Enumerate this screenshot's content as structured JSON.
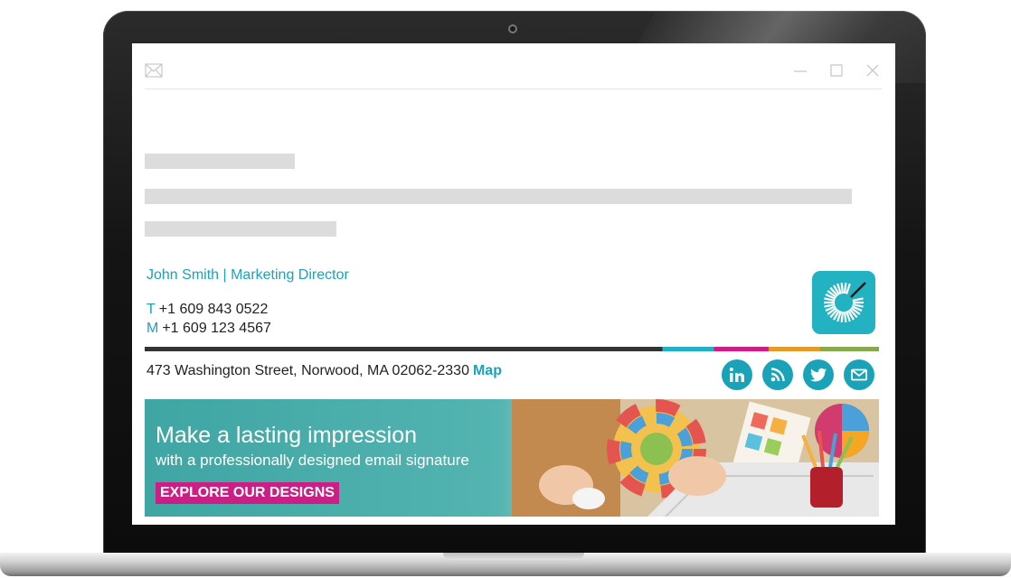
{
  "signature": {
    "name_line": "John Smith | Marketing Director",
    "phone_key": "T",
    "phone": "+1 609 843 0522",
    "mobile_key": "M",
    "mobile": "+1 609 123 4567",
    "address": "473 Washington Street, Norwood, MA 02062-2330",
    "map_link": "Map"
  },
  "social_icons": [
    "linkedin-icon",
    "rss-icon",
    "twitter-icon",
    "email-icon"
  ],
  "banner": {
    "headline": "Make a lasting impression",
    "subline": "with a professionally designed email signature",
    "cta": "EXPLORE OUR DESIGNS"
  },
  "colors": {
    "accent_teal": "#1aa3b8",
    "divider_dark": "#333333",
    "divider_teal": "#21b0c5",
    "divider_magenta": "#d11b86",
    "divider_orange": "#e79a2c",
    "divider_green": "#86a94d",
    "cta_magenta": "#cc1f85"
  }
}
